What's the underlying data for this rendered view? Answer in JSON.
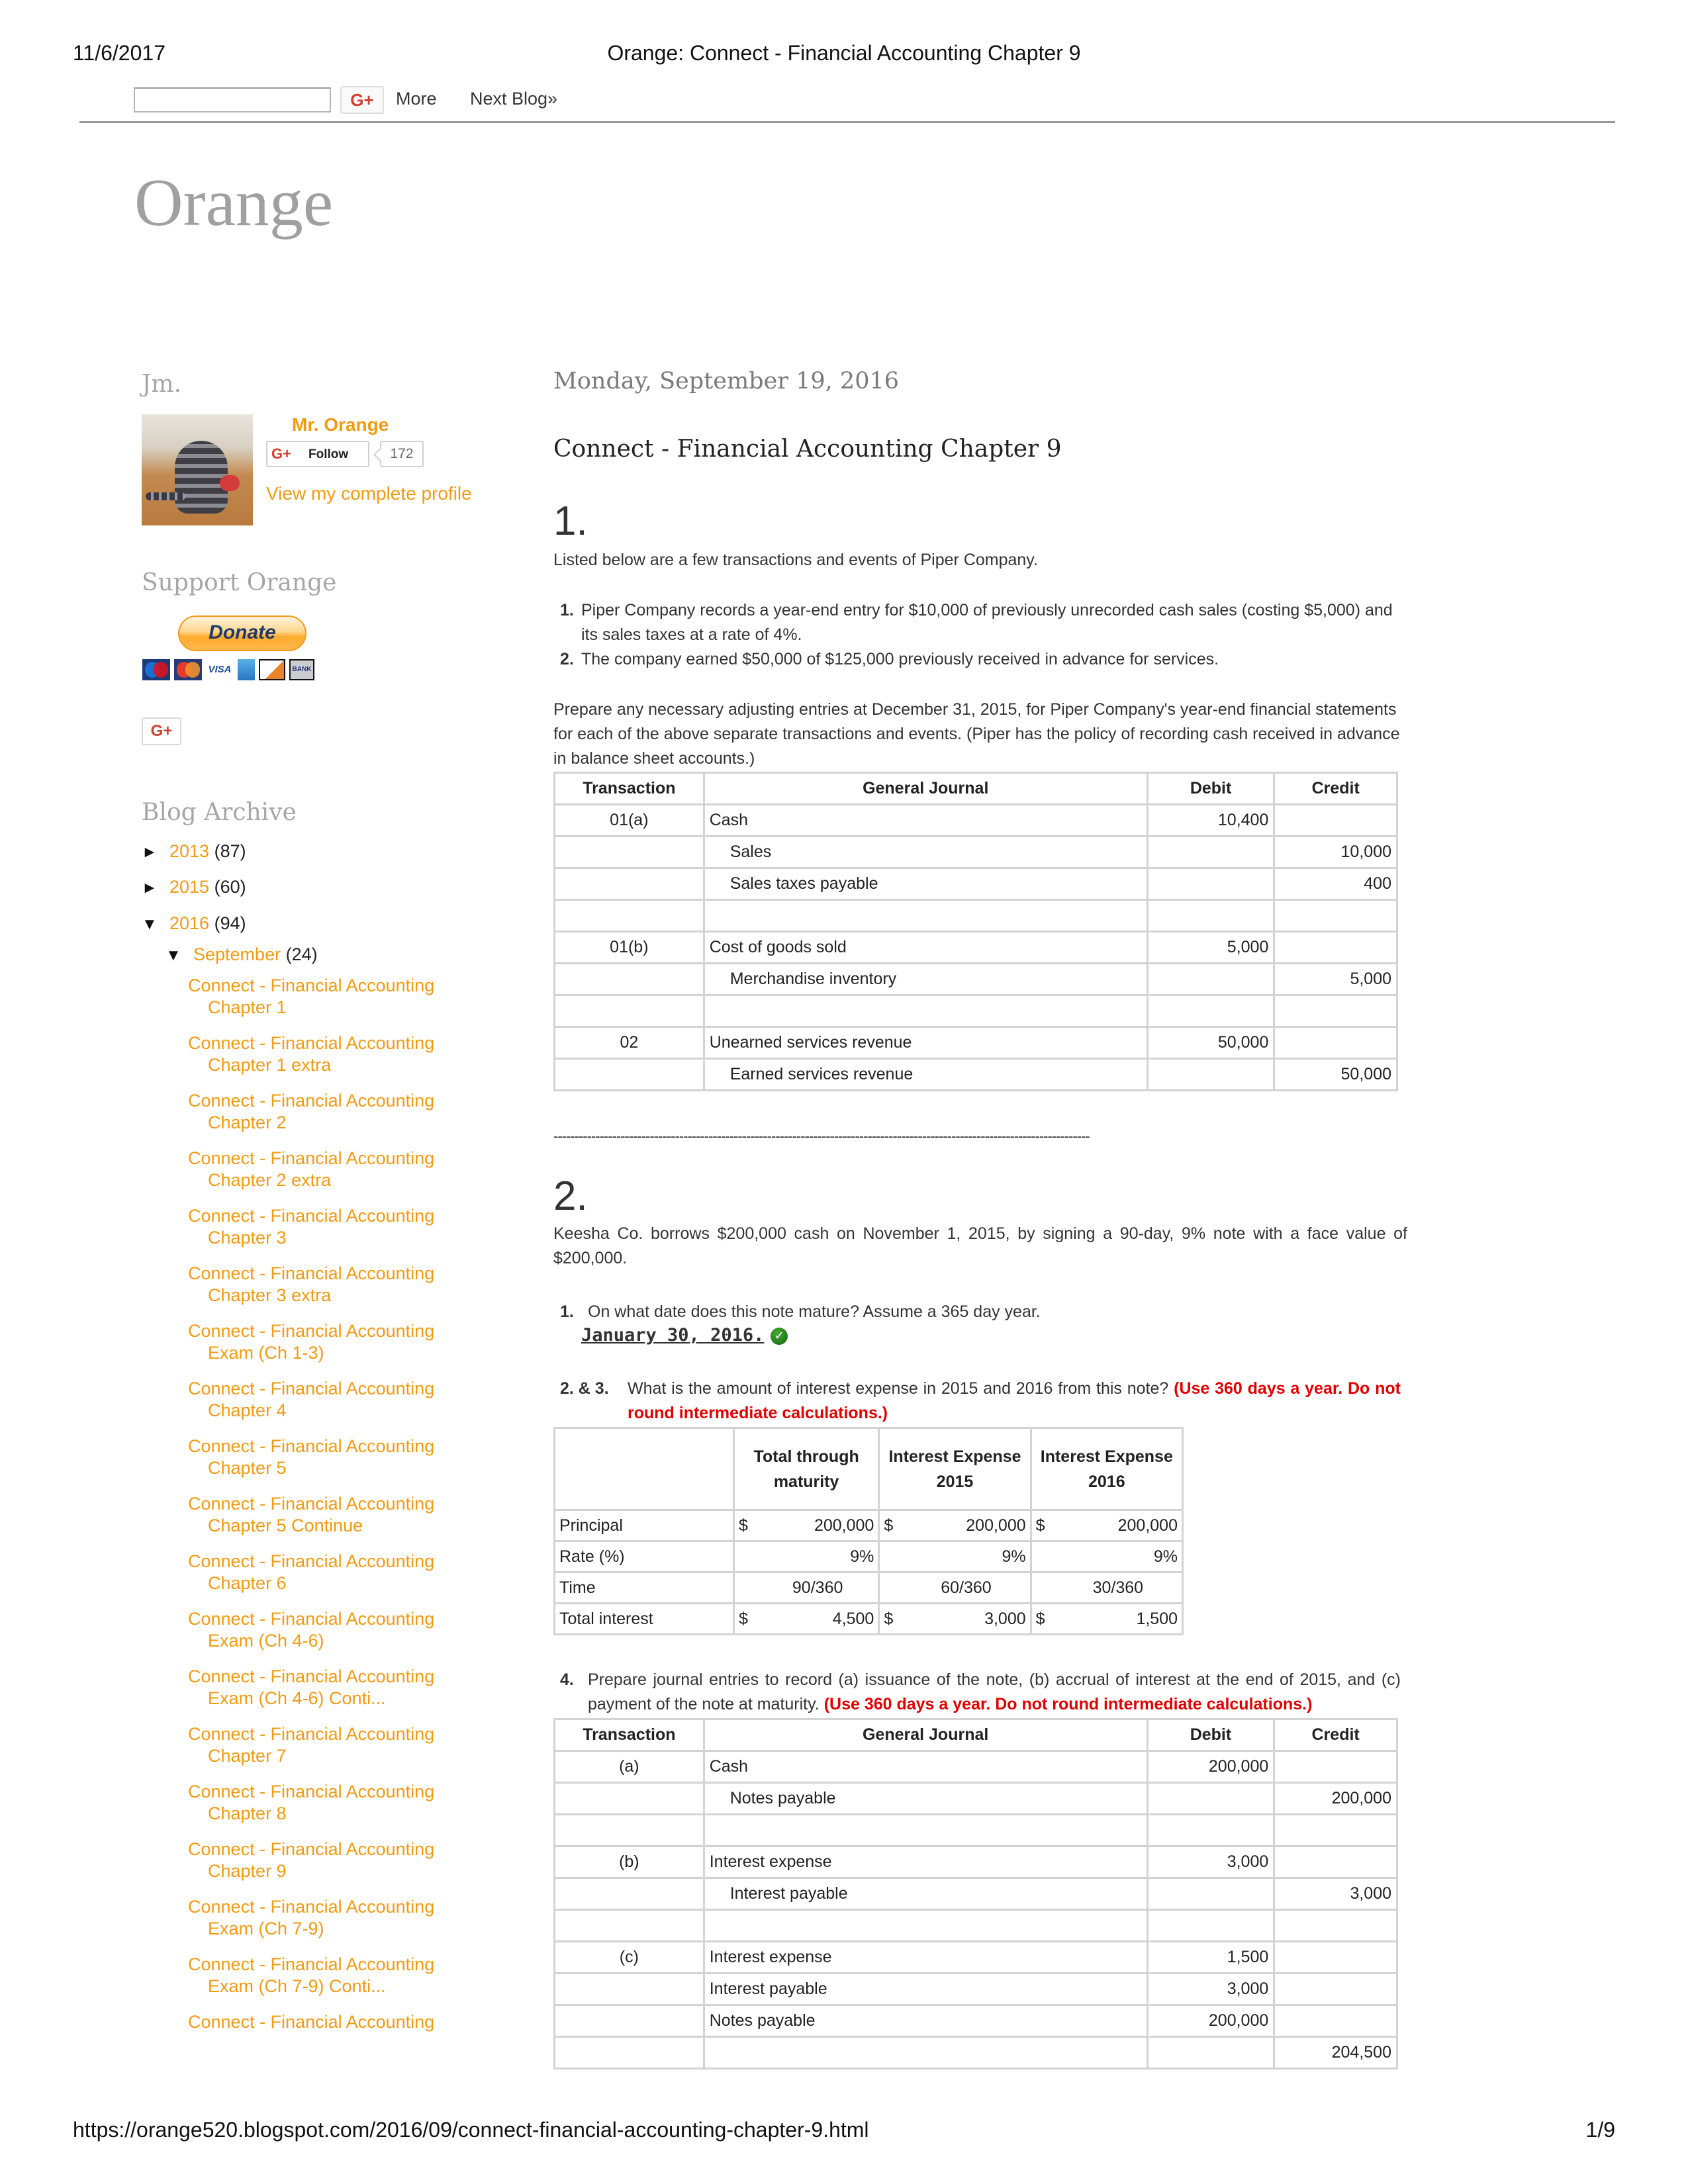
{
  "print_header": {
    "date": "11/6/2017",
    "title": "Orange: Connect - Financial Accounting Chapter 9"
  },
  "navbar": {
    "search_placeholder": "",
    "gplus_label": "G+",
    "more_label": "More",
    "next_blog_label": "Next Blog»"
  },
  "blog": {
    "title": "Orange"
  },
  "sidebar": {
    "profile": {
      "title": "Jm.",
      "name": "Mr. Orange",
      "gplus_glyph": "G+",
      "follow_label": "Follow",
      "follower_count": "172",
      "view_profile_label": "View my complete profile"
    },
    "support": {
      "title": "Support Orange",
      "donate_label": "Donate",
      "payment_icons": [
        "maestro-card-icon",
        "mastercard-icon",
        "visa-card-icon",
        "amex-card-icon",
        "discover-card-icon",
        "bank-icon"
      ],
      "visa_text": "VISA",
      "bank_text": "BANK"
    },
    "gplus_share_label": "G+",
    "archive": {
      "title": "Blog Archive",
      "years": [
        {
          "year": "2013",
          "count": "(87)",
          "expanded": false,
          "toggle": "►"
        },
        {
          "year": "2015",
          "count": "(60)",
          "expanded": false,
          "toggle": "►"
        },
        {
          "year": "2016",
          "count": "(94)",
          "expanded": true,
          "toggle": "▼"
        }
      ],
      "month": {
        "name": "September",
        "count": "(24)",
        "toggle": "▼"
      },
      "posts": [
        {
          "line1": "Connect - Financial Accounting",
          "line2": "Chapter 1"
        },
        {
          "line1": "Connect - Financial Accounting",
          "line2": "Chapter 1 extra"
        },
        {
          "line1": "Connect - Financial Accounting",
          "line2": "Chapter 2"
        },
        {
          "line1": "Connect - Financial Accounting",
          "line2": "Chapter 2 extra"
        },
        {
          "line1": "Connect - Financial Accounting",
          "line2": "Chapter 3"
        },
        {
          "line1": "Connect - Financial Accounting",
          "line2": "Chapter 3 extra"
        },
        {
          "line1": "Connect - Financial Accounting",
          "line2": "Exam (Ch 1-3)"
        },
        {
          "line1": "Connect - Financial Accounting",
          "line2": "Chapter 4"
        },
        {
          "line1": "Connect - Financial Accounting",
          "line2": "Chapter 5"
        },
        {
          "line1": "Connect - Financial Accounting",
          "line2": "Chapter 5 Continue"
        },
        {
          "line1": "Connect - Financial Accounting",
          "line2": "Chapter 6"
        },
        {
          "line1": "Connect - Financial Accounting",
          "line2": "Exam (Ch 4-6)"
        },
        {
          "line1": "Connect - Financial Accounting",
          "line2": "Exam (Ch 4-6) Conti..."
        },
        {
          "line1": "Connect - Financial Accounting",
          "line2": "Chapter 7"
        },
        {
          "line1": "Connect - Financial Accounting",
          "line2": "Chapter 8"
        },
        {
          "line1": "Connect - Financial Accounting",
          "line2": "Chapter 9"
        },
        {
          "line1": "Connect - Financial Accounting",
          "line2": "Exam (Ch 7-9)"
        },
        {
          "line1": "Connect - Financial Accounting",
          "line2": "Exam (Ch 7-9) Conti..."
        },
        {
          "line1": "Connect - Financial Accounting",
          "line2": ""
        }
      ]
    }
  },
  "post": {
    "date": "Monday, September 19, 2016",
    "title": "Connect - Financial Accounting Chapter 9",
    "q1": {
      "number": "1.",
      "intro": "Listed below are a few transactions and events of Piper Company.",
      "items": [
        {
          "num": "1.",
          "text": "Piper Company records a year-end entry for $10,000 of previously unrecorded cash sales (costing $5,000) and its sales taxes at a rate of 4%."
        },
        {
          "num": "2.",
          "text": "The company earned $50,000 of $125,000 previously received in advance for services."
        }
      ],
      "instructions": "Prepare any necessary adjusting entries at December 31, 2015, for Piper Company's year-end financial statements for each of the above separate transactions and events. (Piper has the policy of recording cash received in advance in balance sheet accounts.)",
      "table": {
        "headers": [
          "Transaction",
          "General Journal",
          "Debit",
          "Credit"
        ],
        "rows": [
          {
            "transaction": "01(a)",
            "account": "Cash",
            "indent": false,
            "debit": "10,400",
            "credit": ""
          },
          {
            "transaction": "",
            "account": "Sales",
            "indent": true,
            "debit": "",
            "credit": "10,000"
          },
          {
            "transaction": "",
            "account": "Sales taxes payable",
            "indent": true,
            "debit": "",
            "credit": "400"
          },
          {
            "transaction": "",
            "account": "",
            "indent": false,
            "debit": "",
            "credit": ""
          },
          {
            "transaction": "01(b)",
            "account": "Cost of goods sold",
            "indent": false,
            "debit": "5,000",
            "credit": ""
          },
          {
            "transaction": "",
            "account": "Merchandise inventory",
            "indent": true,
            "debit": "",
            "credit": "5,000"
          },
          {
            "transaction": "",
            "account": "",
            "indent": false,
            "debit": "",
            "credit": ""
          },
          {
            "transaction": "02",
            "account": "Unearned services revenue",
            "indent": false,
            "debit": "50,000",
            "credit": ""
          },
          {
            "transaction": "",
            "account": "Earned services revenue",
            "indent": true,
            "debit": "",
            "credit": "50,000"
          }
        ]
      }
    },
    "separator": "--------------------------------------------------------------------------------------------------------------------------------",
    "q2": {
      "number": "2.",
      "intro": "Keesha Co. borrows $200,000 cash on November 1, 2015, by signing a 90-day, 9% note with a face value of $200,000.",
      "part1": {
        "num": "1.",
        "question": "On what date does this note mature? Assume a 365 day year.",
        "answer": "January 30, 2016.",
        "answer_status": "correct"
      },
      "part23": {
        "num": "2. & 3.",
        "question": "What is the amount of interest expense in 2015 and 2016 from this note?",
        "note": "(Use 360 days a year. Do not round intermediate calculations.)"
      },
      "interest_table": {
        "headers": [
          "",
          "Total through maturity",
          "Interest Expense 2015",
          "Interest Expense 2016"
        ],
        "rows": [
          {
            "label": "Principal",
            "cells": [
              {
                "dollar": "$",
                "value": "200,000"
              },
              {
                "dollar": "$",
                "value": "200,000"
              },
              {
                "dollar": "$",
                "value": "200,000"
              }
            ]
          },
          {
            "label": "Rate (%)",
            "cells": [
              {
                "dollar": "",
                "value": "9%"
              },
              {
                "dollar": "",
                "value": "9%"
              },
              {
                "dollar": "",
                "value": "9%"
              }
            ]
          },
          {
            "label": "Time",
            "cells": [
              {
                "dollar": "",
                "value": "90/360"
              },
              {
                "dollar": "",
                "value": "60/360"
              },
              {
                "dollar": "",
                "value": "30/360"
              }
            ]
          },
          {
            "label": "Total interest",
            "cells": [
              {
                "dollar": "$",
                "value": "4,500"
              },
              {
                "dollar": "$",
                "value": "3,000"
              },
              {
                "dollar": "$",
                "value": "1,500"
              }
            ]
          }
        ]
      },
      "part4": {
        "num": "4.",
        "question": "Prepare journal entries to record (a) issuance of the note, (b) accrual of interest at the end of 2015, and (c) payment of the note at maturity.",
        "note": "(Use 360 days a year. Do not round intermediate calculations.)"
      },
      "journal_table": {
        "headers": [
          "Transaction",
          "General Journal",
          "Debit",
          "Credit"
        ],
        "rows": [
          {
            "transaction": "(a)",
            "account": "Cash",
            "indent": false,
            "debit": "200,000",
            "credit": ""
          },
          {
            "transaction": "",
            "account": "Notes payable",
            "indent": true,
            "debit": "",
            "credit": "200,000"
          },
          {
            "transaction": "",
            "account": "",
            "indent": false,
            "debit": "",
            "credit": ""
          },
          {
            "transaction": "(b)",
            "account": "Interest expense",
            "indent": false,
            "debit": "3,000",
            "credit": ""
          },
          {
            "transaction": "",
            "account": "Interest payable",
            "indent": true,
            "debit": "",
            "credit": "3,000"
          },
          {
            "transaction": "",
            "account": "",
            "indent": false,
            "debit": "",
            "credit": ""
          },
          {
            "transaction": "(c)",
            "account": "Interest expense",
            "indent": false,
            "debit": "1,500",
            "credit": ""
          },
          {
            "transaction": "",
            "account": "Interest payable",
            "indent": false,
            "debit": "3,000",
            "credit": ""
          },
          {
            "transaction": "",
            "account": "Notes payable",
            "indent": false,
            "debit": "200,000",
            "credit": ""
          },
          {
            "transaction": "",
            "account": "",
            "indent": false,
            "debit": "",
            "credit": "204,500"
          }
        ]
      }
    }
  },
  "print_footer": {
    "url": "https://orange520.blogspot.com/2016/09/connect-financial-accounting-chapter-9.html",
    "page": "1/9"
  }
}
